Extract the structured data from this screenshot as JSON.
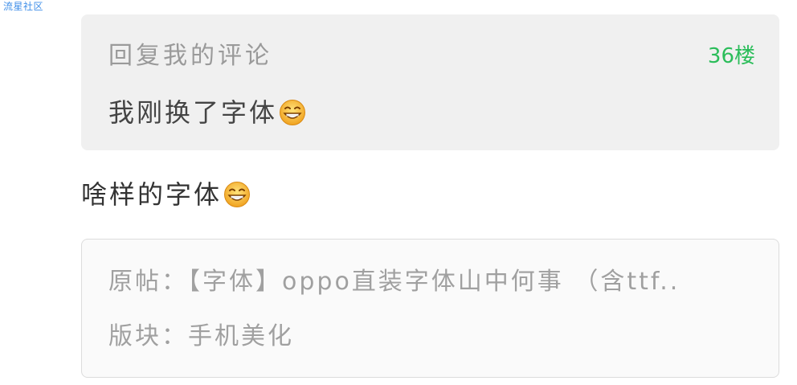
{
  "watermark": "流星社区",
  "quoted_comment": {
    "title": "回复我的评论",
    "floor": "36楼",
    "text": "我刚换了字体",
    "emoji": "grinning-squint-emoji"
  },
  "reply": {
    "text": "啥样的字体",
    "emoji": "grinning-squint-emoji"
  },
  "original_post": {
    "post_line": "原帖：【字体】oppo直装字体山中何事 （含ttf..",
    "board_line": "版块：手机美化"
  },
  "colors": {
    "floor_green": "#2bbd5a",
    "watermark_blue": "#3e8ee8",
    "quote_bg": "#f0f0f0",
    "emoji_yellow": "#f5b82e"
  }
}
